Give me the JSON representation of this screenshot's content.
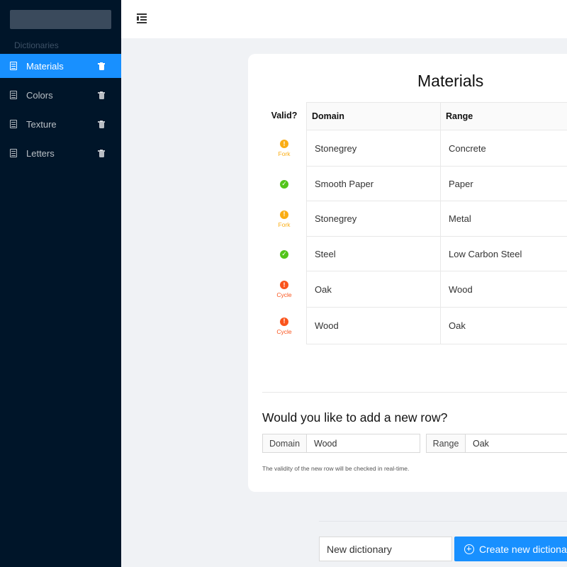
{
  "sidebar": {
    "group_label": "Dictionaries",
    "items": [
      {
        "label": "Materials",
        "active": true
      },
      {
        "label": "Colors",
        "active": false
      },
      {
        "label": "Texture",
        "active": false
      },
      {
        "label": "Letters",
        "active": false
      }
    ]
  },
  "header": {
    "menu_icon": "menu-fold-icon"
  },
  "main": {
    "title": "Materials",
    "table": {
      "columns": [
        "Valid?",
        "Domain",
        "Range"
      ],
      "rows": [
        {
          "status": "warning",
          "status_label": "Fork",
          "domain": "Stonegrey",
          "range": "Concrete"
        },
        {
          "status": "ok",
          "status_label": "",
          "domain": "Smooth Paper",
          "range": "Paper"
        },
        {
          "status": "warning",
          "status_label": "Fork",
          "domain": "Stonegrey",
          "range": "Metal"
        },
        {
          "status": "ok",
          "status_label": "",
          "domain": "Steel",
          "range": "Low Carbon Steel"
        },
        {
          "status": "error",
          "status_label": "Cycle",
          "domain": "Oak",
          "range": "Wood"
        },
        {
          "status": "error",
          "status_label": "Cycle",
          "domain": "Wood",
          "range": "Oak"
        }
      ]
    },
    "add_row": {
      "title": "Would you like to add a new row?",
      "domain_label": "Domain",
      "domain_value": "Wood",
      "range_label": "Range",
      "range_value": "Oak",
      "hint": "The validity of the new row will be checked in real-time."
    }
  },
  "footer": {
    "new_dictionary_value": "New dictionary",
    "create_button_label": "Create new dictiona"
  },
  "colors": {
    "sidebar_bg": "#001529",
    "accent": "#1890ff",
    "warning": "#faad14",
    "ok": "#52c41a",
    "error": "#fa541c"
  }
}
